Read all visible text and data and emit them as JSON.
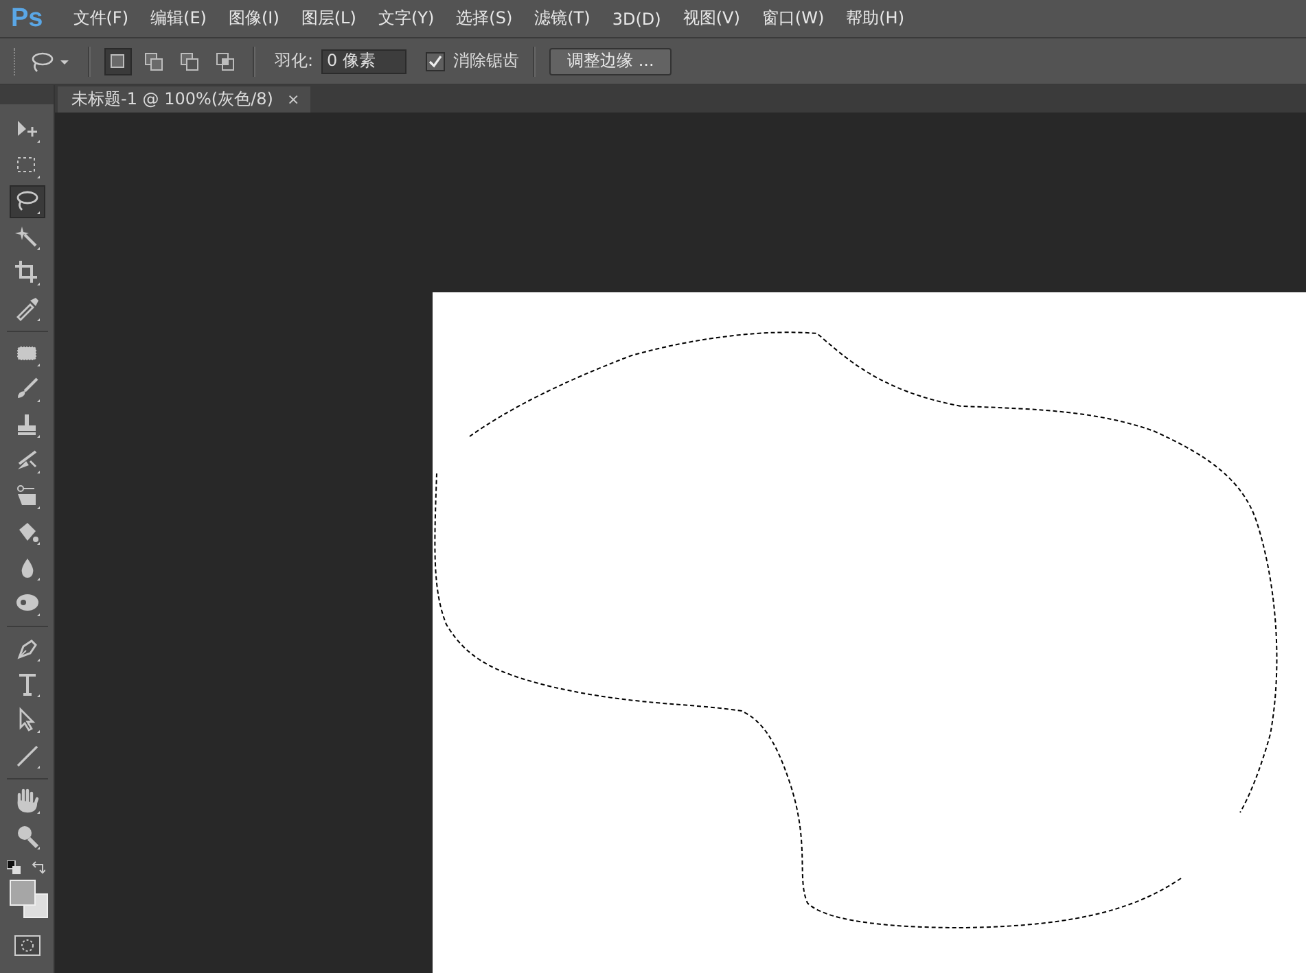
{
  "app_logo": "Ps",
  "menu": [
    "文件(F)",
    "编辑(E)",
    "图像(I)",
    "图层(L)",
    "文字(Y)",
    "选择(S)",
    "滤镜(T)",
    "3D(D)",
    "视图(V)",
    "窗口(W)",
    "帮助(H)"
  ],
  "options_bar": {
    "modes": [
      {
        "selected": true
      },
      {
        "selected": false
      },
      {
        "selected": false
      },
      {
        "selected": false
      }
    ],
    "feather_label": "羽化:",
    "feather_value": "0 像素",
    "antialias": {
      "label": "消除锯齿",
      "checked": true
    },
    "refine_button": "调整边缘 ..."
  },
  "document_tab": {
    "title": "未标题-1 @ 100%(灰色/8)",
    "close": "×"
  },
  "tools": [
    {
      "kind": "move",
      "selected": false
    },
    {
      "kind": "marquee",
      "selected": false
    },
    {
      "kind": "lasso",
      "selected": true
    },
    {
      "kind": "wand",
      "selected": false
    },
    {
      "kind": "crop",
      "selected": false
    },
    {
      "kind": "eyedropper",
      "selected": false
    },
    {
      "kind": "healing",
      "selected": false
    },
    {
      "kind": "brush",
      "selected": false
    },
    {
      "kind": "stamp",
      "selected": false
    },
    {
      "kind": "history",
      "selected": false
    },
    {
      "kind": "eraser",
      "selected": false
    },
    {
      "kind": "bucket",
      "selected": false
    },
    {
      "kind": "blur",
      "selected": false
    },
    {
      "kind": "dodge",
      "selected": false
    },
    {
      "kind": "pen",
      "selected": false
    },
    {
      "kind": "type",
      "selected": false
    },
    {
      "kind": "path-select",
      "selected": false
    },
    {
      "kind": "line",
      "selected": false
    },
    {
      "kind": "hand",
      "selected": false
    },
    {
      "kind": "zoom",
      "selected": false
    }
  ]
}
